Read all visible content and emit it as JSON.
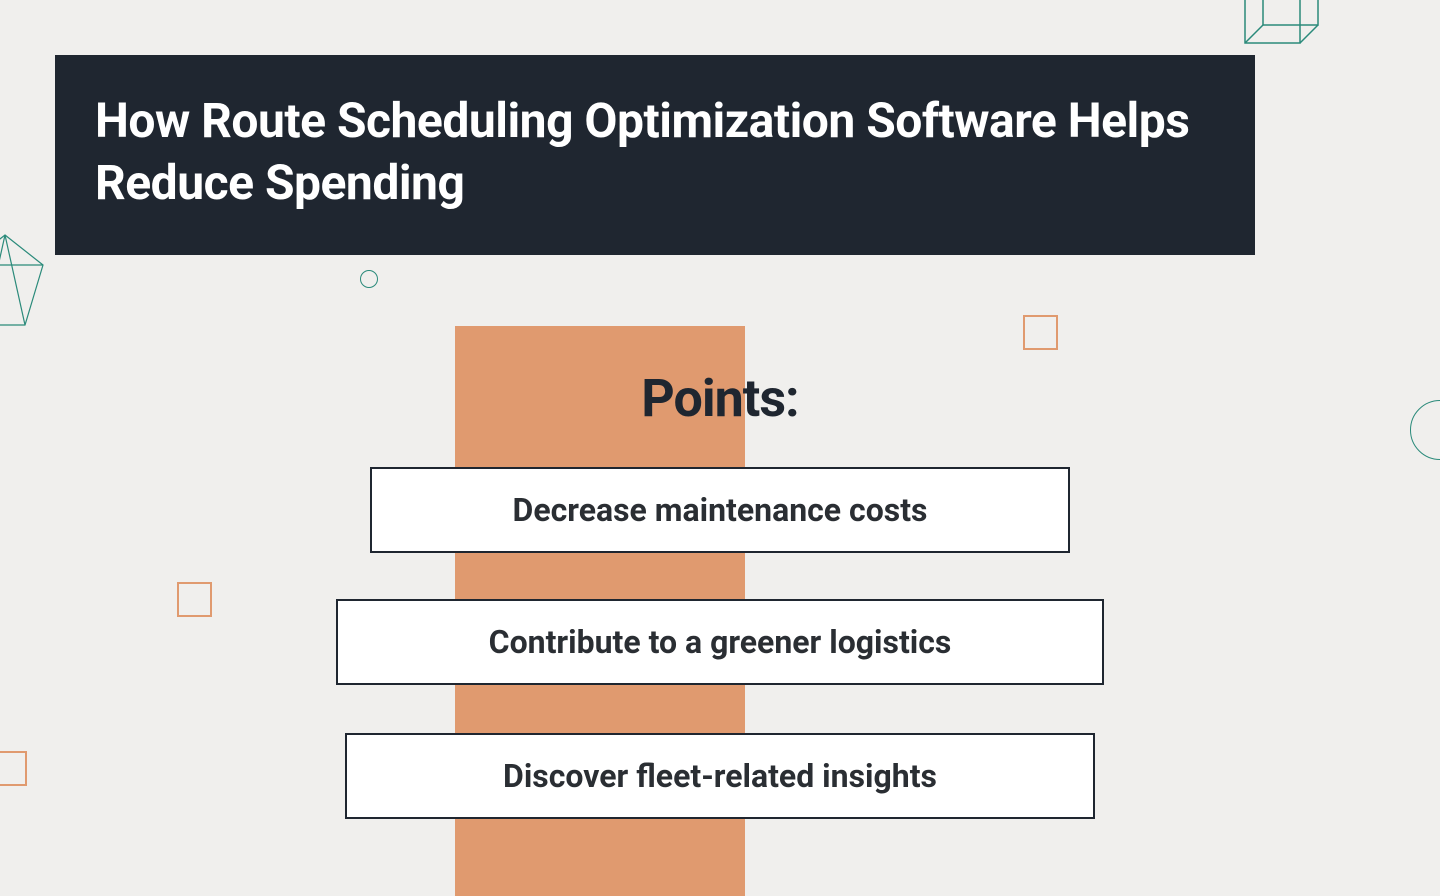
{
  "title": "How Route Scheduling Optimization Software Helps Reduce Spending",
  "points_heading": "Points:",
  "points": [
    "Decrease maintenance costs",
    "Contribute to a greener logistics",
    "Discover fleet-related insights"
  ],
  "colors": {
    "background": "#f0efed",
    "banner": "#1f2630",
    "accent": "#e09a6f",
    "teal": "#2a8a7a"
  }
}
